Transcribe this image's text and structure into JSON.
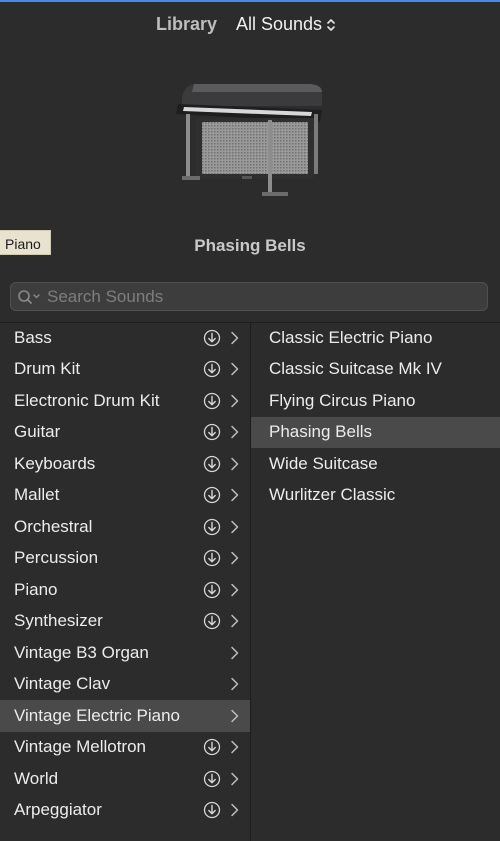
{
  "header": {
    "library_label": "Library",
    "sounds_select": "All Sounds"
  },
  "hero": {
    "instrument_image": "electric-piano",
    "preset_name": "Phasing Bells"
  },
  "tooltip": {
    "text": "Piano"
  },
  "search": {
    "placeholder": "Search Sounds",
    "value": ""
  },
  "categories": [
    {
      "label": "Bass",
      "download": true,
      "selected": false
    },
    {
      "label": "Drum Kit",
      "download": true,
      "selected": false
    },
    {
      "label": "Electronic Drum Kit",
      "download": true,
      "selected": false
    },
    {
      "label": "Guitar",
      "download": true,
      "selected": false
    },
    {
      "label": "Keyboards",
      "download": true,
      "selected": false
    },
    {
      "label": "Mallet",
      "download": true,
      "selected": false
    },
    {
      "label": "Orchestral",
      "download": true,
      "selected": false
    },
    {
      "label": "Percussion",
      "download": true,
      "selected": false
    },
    {
      "label": "Piano",
      "download": true,
      "selected": false
    },
    {
      "label": "Synthesizer",
      "download": true,
      "selected": false
    },
    {
      "label": "Vintage B3 Organ",
      "download": false,
      "selected": false
    },
    {
      "label": "Vintage Clav",
      "download": false,
      "selected": false
    },
    {
      "label": "Vintage Electric Piano",
      "download": false,
      "selected": true
    },
    {
      "label": "Vintage Mellotron",
      "download": true,
      "selected": false
    },
    {
      "label": "World",
      "download": true,
      "selected": false
    },
    {
      "label": "Arpeggiator",
      "download": true,
      "selected": false
    }
  ],
  "patches": [
    {
      "label": "Classic Electric Piano",
      "selected": false
    },
    {
      "label": "Classic Suitcase Mk IV",
      "selected": false
    },
    {
      "label": "Flying Circus Piano",
      "selected": false
    },
    {
      "label": "Phasing Bells",
      "selected": true
    },
    {
      "label": "Wide Suitcase",
      "selected": false
    },
    {
      "label": "Wurlitzer Classic",
      "selected": false
    }
  ],
  "colors": {
    "background": "#2c2c2c",
    "selected_row": "#4a4a4a",
    "accent_line": "#4d8ad6",
    "tooltip_bg": "#e8e3cf"
  }
}
